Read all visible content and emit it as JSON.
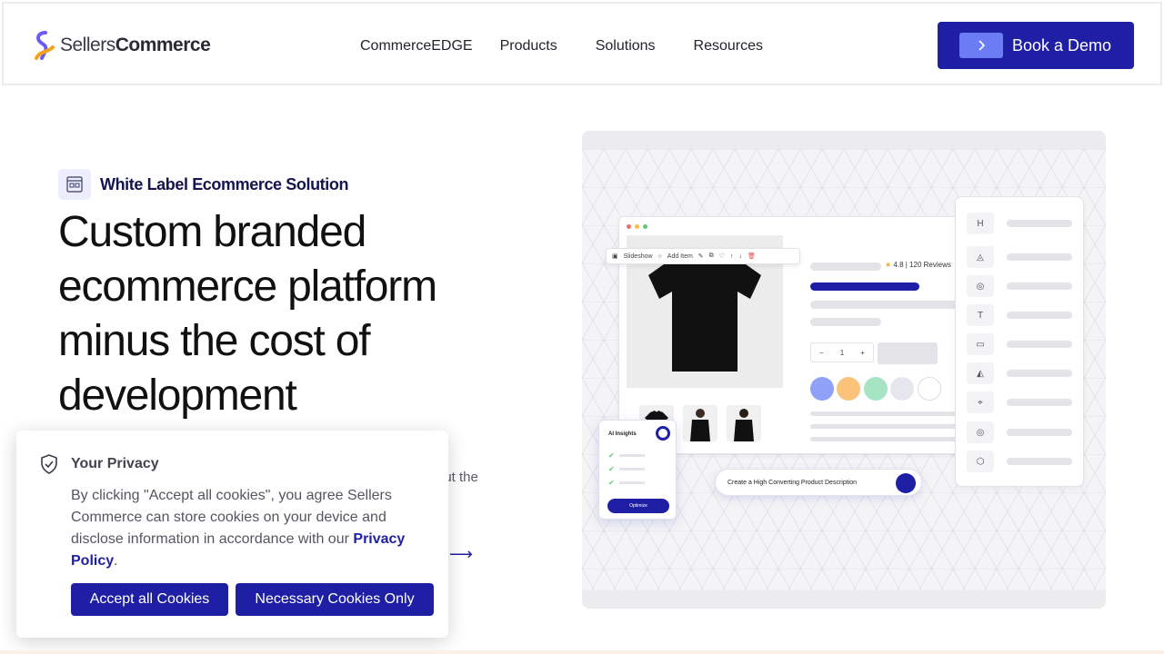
{
  "header": {
    "logo_text_light": "Sellers",
    "logo_text_bold": "Commerce",
    "nav": [
      "CommerceEDGE",
      "Products",
      "Solutions",
      "Resources"
    ],
    "demo_label": "Book a Demo",
    "demo_icon": "chevron-right-icon"
  },
  "hero": {
    "badge_label": "White Label Ecommerce Solution",
    "title": "Custom branded ecommerce platform minus the cost of development",
    "sub_line1": "d",
    "sub_line2": "out the",
    "link_arrow": "⟶"
  },
  "visual": {
    "toolbar_slideshow": "Slideshow",
    "toolbar_add_item": "Add Item",
    "rating_text": "4.8 | 120 Reviews",
    "qty_minus": "−",
    "qty_value": "1",
    "qty_plus": "+",
    "side_icons": [
      "H",
      "◬",
      "◎",
      "T",
      "▭",
      "◭",
      "⌖",
      "◎",
      "⬡"
    ],
    "ai_title": "AI Insights",
    "ai_button": "Optimize",
    "prompt_text": "Create a High Converting Product Description",
    "swatch_colors": [
      "#8fa2f8",
      "#fbc27a",
      "#a7e4c4",
      "#e6e6ee",
      "#ffffff"
    ]
  },
  "cookie": {
    "title": "Your Privacy",
    "body_text": "By clicking \"Accept all cookies\", you agree Sellers Commerce can store cookies on your device and disclose information in accordance with our",
    "policy_link": "Privacy Policy",
    "period": ".",
    "accept_label": "Accept all Cookies",
    "necessary_label": "Necessary Cookies Only"
  },
  "colors": {
    "brand": "#1f1fa6",
    "accent": "#6c7cf5"
  }
}
